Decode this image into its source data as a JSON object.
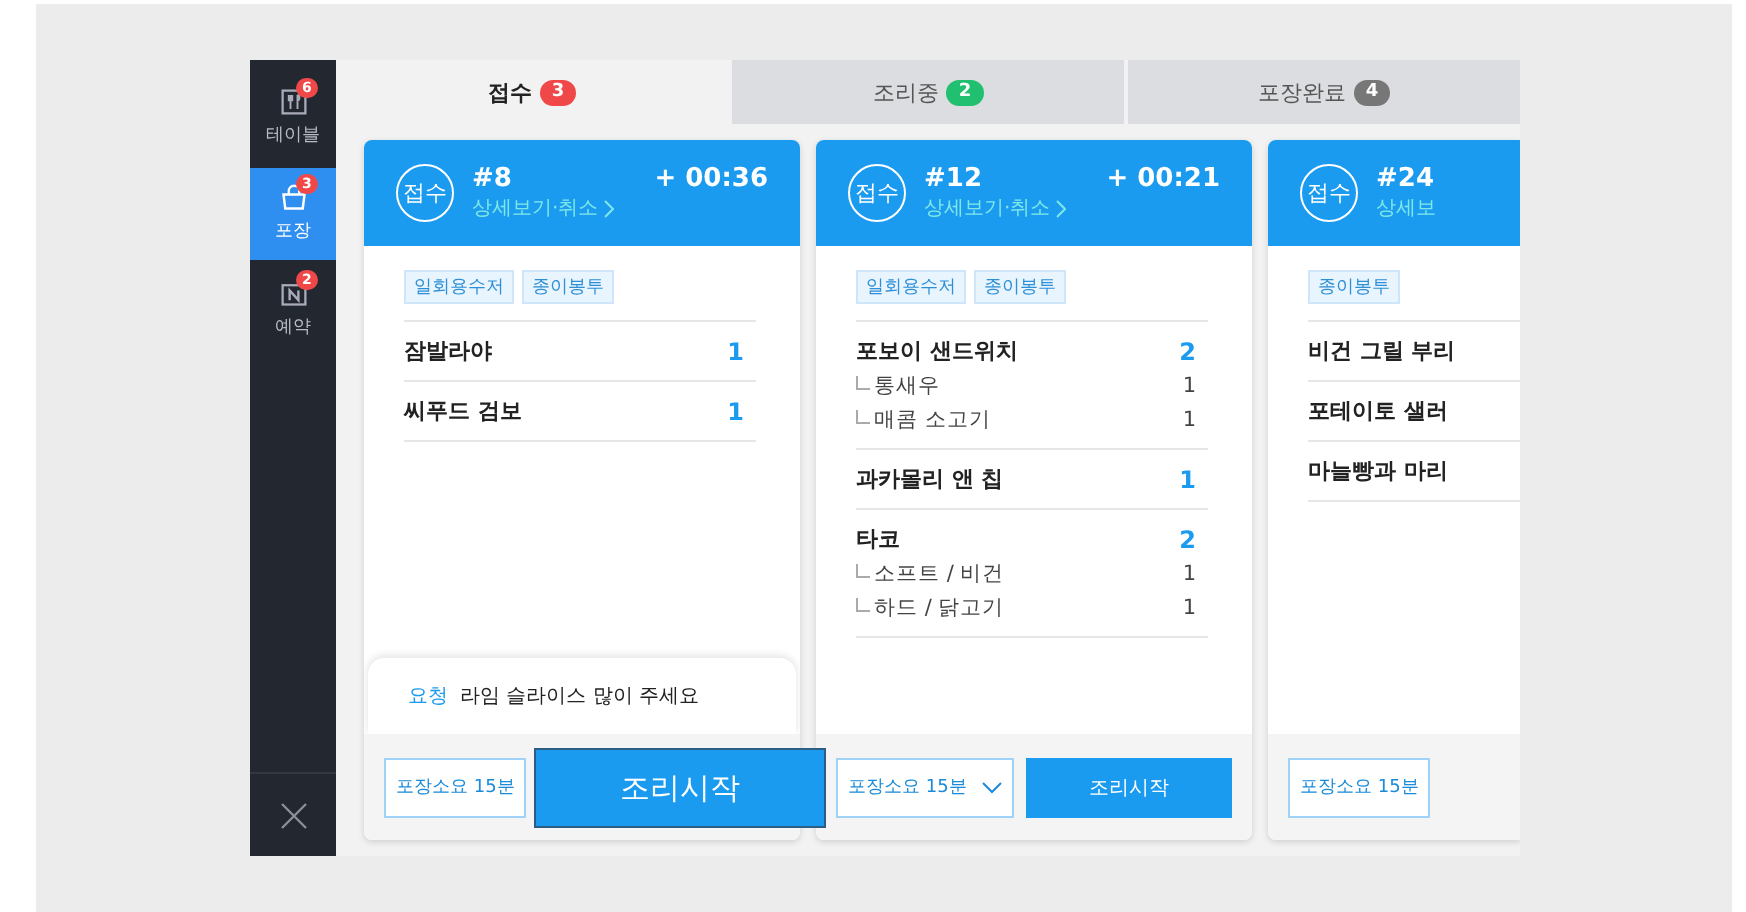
{
  "sidebar": {
    "items": [
      {
        "label": "테이블",
        "badge": "6",
        "kind": "table",
        "selected": false
      },
      {
        "label": "포장",
        "badge": "3",
        "kind": "bag",
        "selected": true
      },
      {
        "label": "예약",
        "badge": "2",
        "kind": "reserve",
        "selected": false
      }
    ]
  },
  "tabs": [
    {
      "label": "접수",
      "count": "3",
      "color": "#f04848",
      "selected": true
    },
    {
      "label": "조리중",
      "count": "2",
      "color": "#20c070",
      "selected": false
    },
    {
      "label": "포장완료",
      "count": "4",
      "color": "#777777",
      "selected": false
    }
  ],
  "cards": [
    {
      "status": "접수",
      "number": "#8",
      "link": "상세보기·취소",
      "elapsed": "+ 00:36",
      "tags": [
        "일회용수저",
        "종이봉투"
      ],
      "items": [
        {
          "name": "잠발라야",
          "qty": "1"
        },
        {
          "name": "씨푸드 검보",
          "qty": "1"
        }
      ],
      "request": {
        "label": "요청",
        "text": "라임 슬라이스 많이 주세요"
      },
      "prep_time": "포장소요 15분"
    },
    {
      "status": "접수",
      "number": "#12",
      "link": "상세보기·취소",
      "elapsed": "+ 00:21",
      "tags": [
        "일회용수저",
        "종이봉투"
      ],
      "items": [
        {
          "name": "포보이 샌드위치",
          "qty": "2",
          "options": [
            {
              "name": "통새우",
              "qty": "1"
            },
            {
              "name": "매콤 소고기",
              "qty": "1"
            }
          ]
        },
        {
          "name": "과카몰리 앤 칩",
          "qty": "1"
        },
        {
          "name": "타코",
          "qty": "2",
          "options": [
            {
              "name": "소프트 / 비건",
              "qty": "1"
            },
            {
              "name": "하드 / 닭고기",
              "qty": "1"
            }
          ]
        }
      ],
      "prep_time": "포장소요 15분",
      "action": "조리시작"
    },
    {
      "status": "접수",
      "number": "#24",
      "link": "상세보",
      "tags": [
        "종이봉투"
      ],
      "items": [
        {
          "name": "비건 그릴 부리"
        },
        {
          "name": "포테이토 샐러"
        },
        {
          "name": "마늘빵과 마리"
        }
      ],
      "prep_time": "포장소요 15분"
    }
  ],
  "highlight": {
    "label": "조리시작"
  }
}
